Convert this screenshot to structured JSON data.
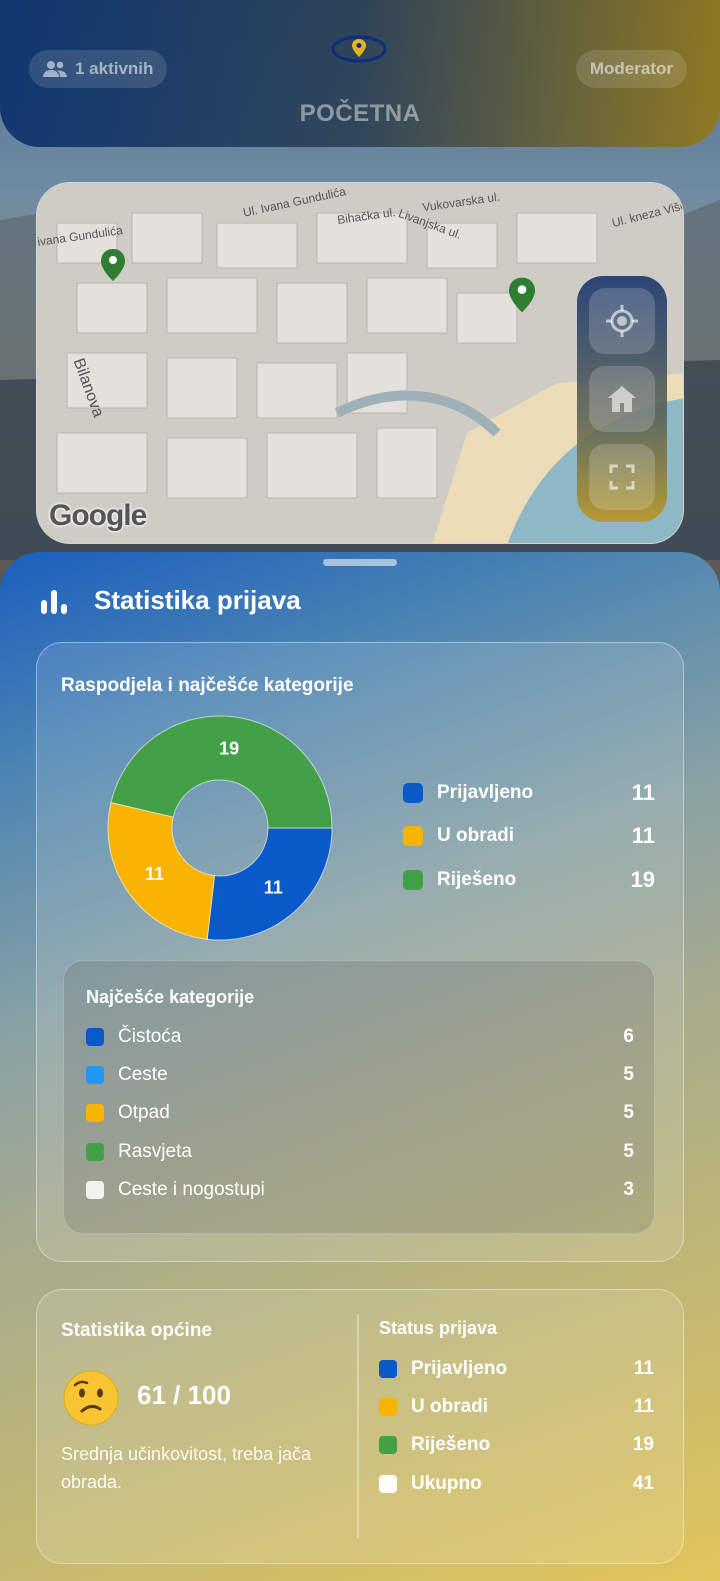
{
  "header": {
    "active_users": "1 aktivnih",
    "role": "Moderator",
    "title": "POČETNA"
  },
  "map": {
    "streets": [
      "Ul. Ivana Gundulića",
      "ivana Gundulića",
      "Bihačka ul.",
      "Vukovarska ul.",
      "Livanjska ul.",
      "Ul. kneza Više",
      "Bilanova"
    ],
    "attribution": "Google",
    "controls": [
      "my-location",
      "home",
      "fullscreen"
    ]
  },
  "stats": {
    "title": "Statistika prijava",
    "distribution_title": "Raspodjela i najčešće kategorije",
    "legend": [
      {
        "label": "Prijavljeno",
        "value": "11",
        "color": "#0a59c8"
      },
      {
        "label": "U obradi",
        "value": "11",
        "color": "#f8b400"
      },
      {
        "label": "Riješeno",
        "value": "19",
        "color": "#43a047"
      }
    ],
    "top_categories_title": "Najčešće kategorije",
    "top_categories": [
      {
        "label": "Čistoća",
        "value": "6",
        "color": "#0a59c8"
      },
      {
        "label": "Ceste",
        "value": "5",
        "color": "#2196f3"
      },
      {
        "label": "Otpad",
        "value": "5",
        "color": "#f8b400"
      },
      {
        "label": "Rasvjeta",
        "value": "5",
        "color": "#43a047"
      },
      {
        "label": "Ceste i nogostupi",
        "value": "3",
        "color": "#f2f2f2"
      }
    ]
  },
  "chart_data": {
    "type": "pie",
    "categories": [
      "Prijavljeno",
      "U obradi",
      "Riješeno"
    ],
    "values": [
      11,
      11,
      19
    ],
    "colors": [
      "#0a59c8",
      "#f8b400",
      "#43a047"
    ],
    "donut": true
  },
  "municipality": {
    "title": "Statistika općine",
    "score": "61 / 100",
    "description": "Srednja učinkovitost, treba jača obrada.",
    "status_title": "Status prijava",
    "status": [
      {
        "label": "Prijavljeno",
        "value": "11",
        "color": "#0a59c8"
      },
      {
        "label": "U obradi",
        "value": "11",
        "color": "#f8b400"
      },
      {
        "label": "Riješeno",
        "value": "19",
        "color": "#43a047"
      },
      {
        "label": "Ukupno",
        "value": "41",
        "color": "#ffffff"
      }
    ]
  }
}
